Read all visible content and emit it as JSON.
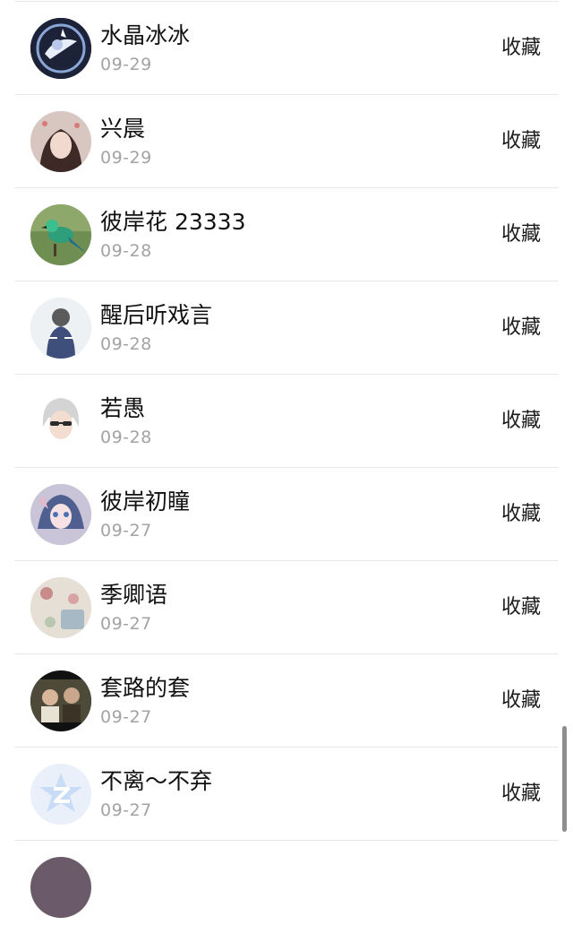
{
  "list": {
    "action_label": "收藏",
    "items": [
      {
        "name": "水晶冰冰",
        "date": "09-29",
        "avatar_icon": "crystal-art-avatar"
      },
      {
        "name": "兴晨",
        "date": "09-29",
        "avatar_icon": "girl-photo-avatar"
      },
      {
        "name": "彼岸花 23333",
        "date": "09-28",
        "avatar_icon": "green-bird-avatar"
      },
      {
        "name": "醒后听戏言",
        "date": "09-28",
        "avatar_icon": "person-back-avatar"
      },
      {
        "name": "若愚",
        "date": "09-28",
        "avatar_icon": "white-hair-anime-avatar"
      },
      {
        "name": "彼岸初瞳",
        "date": "09-27",
        "avatar_icon": "anime-girl-avatar"
      },
      {
        "name": "季卿语",
        "date": "09-27",
        "avatar_icon": "floral-photo-avatar"
      },
      {
        "name": "套路的套",
        "date": "09-27",
        "avatar_icon": "movie-still-avatar"
      },
      {
        "name": "不离～不弃",
        "date": "09-27",
        "avatar_icon": "qq-default-avatar"
      },
      {
        "name": "",
        "date": "",
        "avatar_icon": "partial-avatar"
      }
    ]
  },
  "colors": {
    "name_text": "#111111",
    "date_text": "#a3a3a3",
    "divider": "#e6e6e6",
    "qq_blue": "#c9dcf5"
  }
}
